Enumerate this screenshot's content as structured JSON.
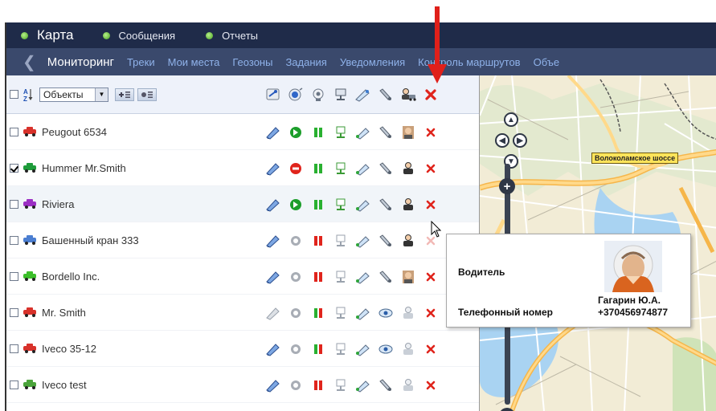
{
  "topbar": {
    "items": [
      {
        "label": "Карта"
      },
      {
        "label": "Сообщения"
      },
      {
        "label": "Отчеты"
      }
    ]
  },
  "nav": {
    "current": "Мониторинг",
    "links": [
      "Треки",
      "Мои места",
      "Геозоны",
      "Задания",
      "Уведомления",
      "Контроль маршрутов",
      "Объе"
    ]
  },
  "toolbar": {
    "select_value": "Объекты"
  },
  "units": [
    {
      "name": "Peugout 6534",
      "checked": false,
      "status": "moving",
      "color": "#d8322b"
    },
    {
      "name": "Hummer Mr.Smith",
      "checked": true,
      "status": "stopped",
      "color": "#1e9c3a"
    },
    {
      "name": "Riviera",
      "checked": false,
      "status": "moving",
      "color": "#9b2fc4"
    },
    {
      "name": "Башенный кран 333",
      "checked": false,
      "status": "inactive",
      "color": "#4b7ed1"
    },
    {
      "name": "Bordello Inc.",
      "checked": false,
      "status": "inactive",
      "color": "#3cbf2a"
    },
    {
      "name": "Mr. Smith",
      "checked": false,
      "status": "inactive",
      "color": "#d8322b"
    },
    {
      "name": "Iveco 35-12",
      "checked": false,
      "status": "inactive",
      "color": "#d8322b"
    },
    {
      "name": "Iveco test",
      "checked": false,
      "status": "inactive",
      "color": "#4aa33a"
    }
  ],
  "map": {
    "road_label": "Волоколамское шоссе"
  },
  "tooltip": {
    "driver_label": "Водитель",
    "phone_label": "Телефонный номер",
    "driver_name": "Гагарин Ю.А.",
    "phone": "+370456974877"
  },
  "colors": {
    "topbar": "#1f2b49",
    "navbar": "#3a496c",
    "nav_link": "#8fb2ea",
    "delete": "#e0241c",
    "arrow": "#e0201a"
  }
}
